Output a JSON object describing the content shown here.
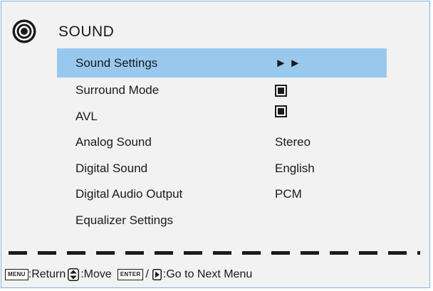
{
  "header": {
    "title": "SOUND",
    "icon": "speaker-icon"
  },
  "menu": {
    "items": [
      {
        "label": "Sound Settings",
        "value": "►►",
        "type": "arrows",
        "selected": true
      },
      {
        "label": "Surround Mode",
        "value": "",
        "type": "checkbox",
        "checked": true
      },
      {
        "label": "AVL",
        "value": "",
        "type": "checkbox",
        "checked": true
      },
      {
        "label": "Analog Sound",
        "value": "Stereo",
        "type": "text"
      },
      {
        "label": "Digital Sound",
        "value": "English",
        "type": "text"
      },
      {
        "label": "Digital Audio Output",
        "value": "PCM",
        "type": "text"
      },
      {
        "label": "Equalizer Settings",
        "value": "",
        "type": "none"
      }
    ]
  },
  "footer": {
    "menu_key": "MENU",
    "return_text": ":Return",
    "move_text": ":Move",
    "enter_key": "ENTER",
    "slash": "/",
    "next_text": ":Go to Next Menu"
  },
  "colors": {
    "highlight": "#99c8ef",
    "panel": "#f2f2f2",
    "border": "#7fb2e0",
    "text": "#1a1a1a"
  }
}
